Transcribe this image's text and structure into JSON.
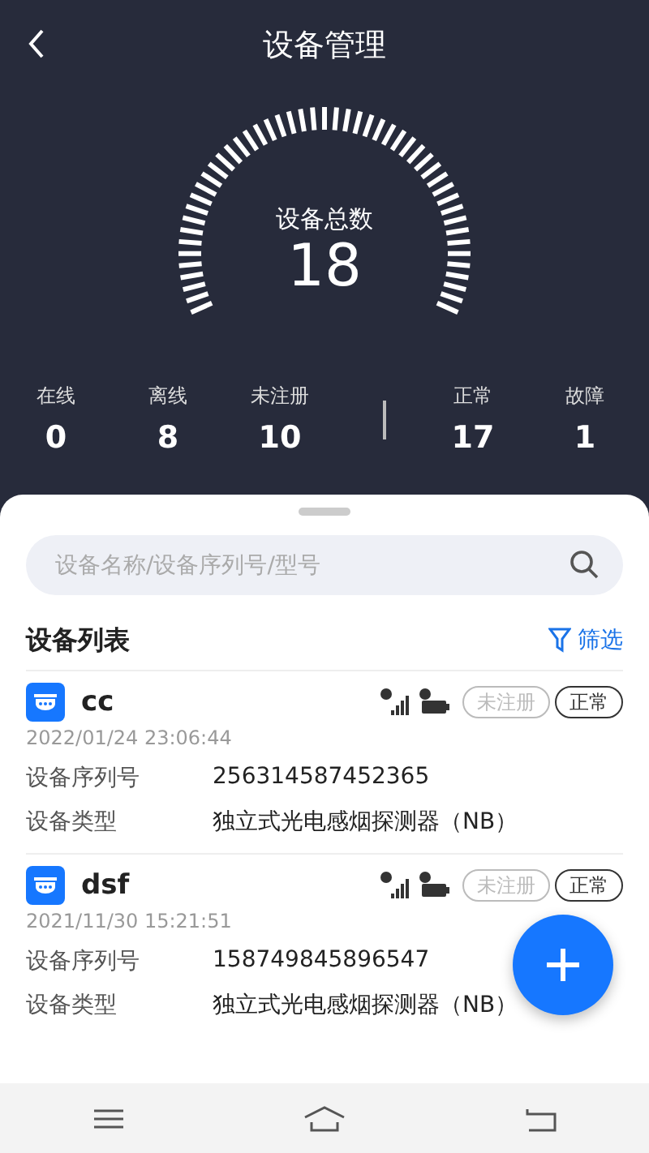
{
  "header": {
    "title": "设备管理"
  },
  "gauge": {
    "label": "设备总数",
    "value": "18"
  },
  "connection_stats": [
    {
      "label": "在线",
      "value": "0"
    },
    {
      "label": "离线",
      "value": "8"
    },
    {
      "label": "未注册",
      "value": "10"
    }
  ],
  "health_stats": [
    {
      "label": "正常",
      "value": "17"
    },
    {
      "label": "故障",
      "value": "1"
    }
  ],
  "search": {
    "placeholder": "设备名称/设备序列号/型号"
  },
  "list": {
    "title": "设备列表",
    "filter_label": "筛选"
  },
  "devices": [
    {
      "name": "cc",
      "time": "2022/01/24 23:06:44",
      "tags": [
        {
          "label": "未注册",
          "active": false
        },
        {
          "label": "正常",
          "active": true
        }
      ],
      "fields": [
        {
          "label": "设备序列号",
          "value": "256314587452365"
        },
        {
          "label": "设备类型",
          "value": "独立式光电感烟探测器（NB）"
        }
      ]
    },
    {
      "name": "dsf",
      "time": "2021/11/30 15:21:51",
      "tags": [
        {
          "label": "未注册",
          "active": false
        },
        {
          "label": "正常",
          "active": true
        }
      ],
      "fields": [
        {
          "label": "设备序列号",
          "value": "158749845896547"
        },
        {
          "label": "设备类型",
          "value": "独立式光电感烟探测器（NB）"
        }
      ]
    }
  ]
}
